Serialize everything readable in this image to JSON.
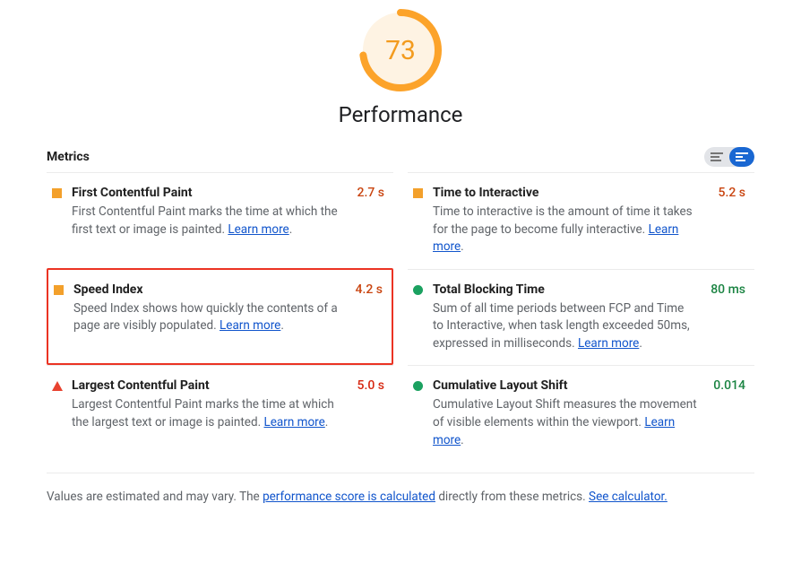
{
  "score": "73",
  "title": "Performance",
  "metrics_label": "Metrics",
  "learn_more": "Learn more",
  "metrics": {
    "fcp": {
      "title": "First Contentful Paint",
      "desc": "First Contentful Paint marks the time at which the first text or image is painted. ",
      "value": "2.7 s"
    },
    "tti": {
      "title": "Time to Interactive",
      "desc": "Time to interactive is the amount of time it takes for the page to become fully interactive. ",
      "value": "5.2 s"
    },
    "si": {
      "title": "Speed Index",
      "desc": "Speed Index shows how quickly the contents of a page are visibly populated. ",
      "value": "4.2 s"
    },
    "tbt": {
      "title": "Total Blocking Time",
      "desc": "Sum of all time periods between FCP and Time to Interactive, when task length exceeded 50ms, expressed in milliseconds. ",
      "value": "80 ms"
    },
    "lcp": {
      "title": "Largest Contentful Paint",
      "desc": "Largest Contentful Paint marks the time at which the largest text or image is painted. ",
      "value": "5.0 s"
    },
    "cls": {
      "title": "Cumulative Layout Shift",
      "desc": "Cumulative Layout Shift measures the movement of visible elements within the viewport. ",
      "value": "0.014"
    }
  },
  "footer": {
    "pre": "Values are estimated and may vary. The ",
    "link1": "performance score is calculated",
    "mid": " directly from these metrics. ",
    "link2": "See calculator."
  }
}
